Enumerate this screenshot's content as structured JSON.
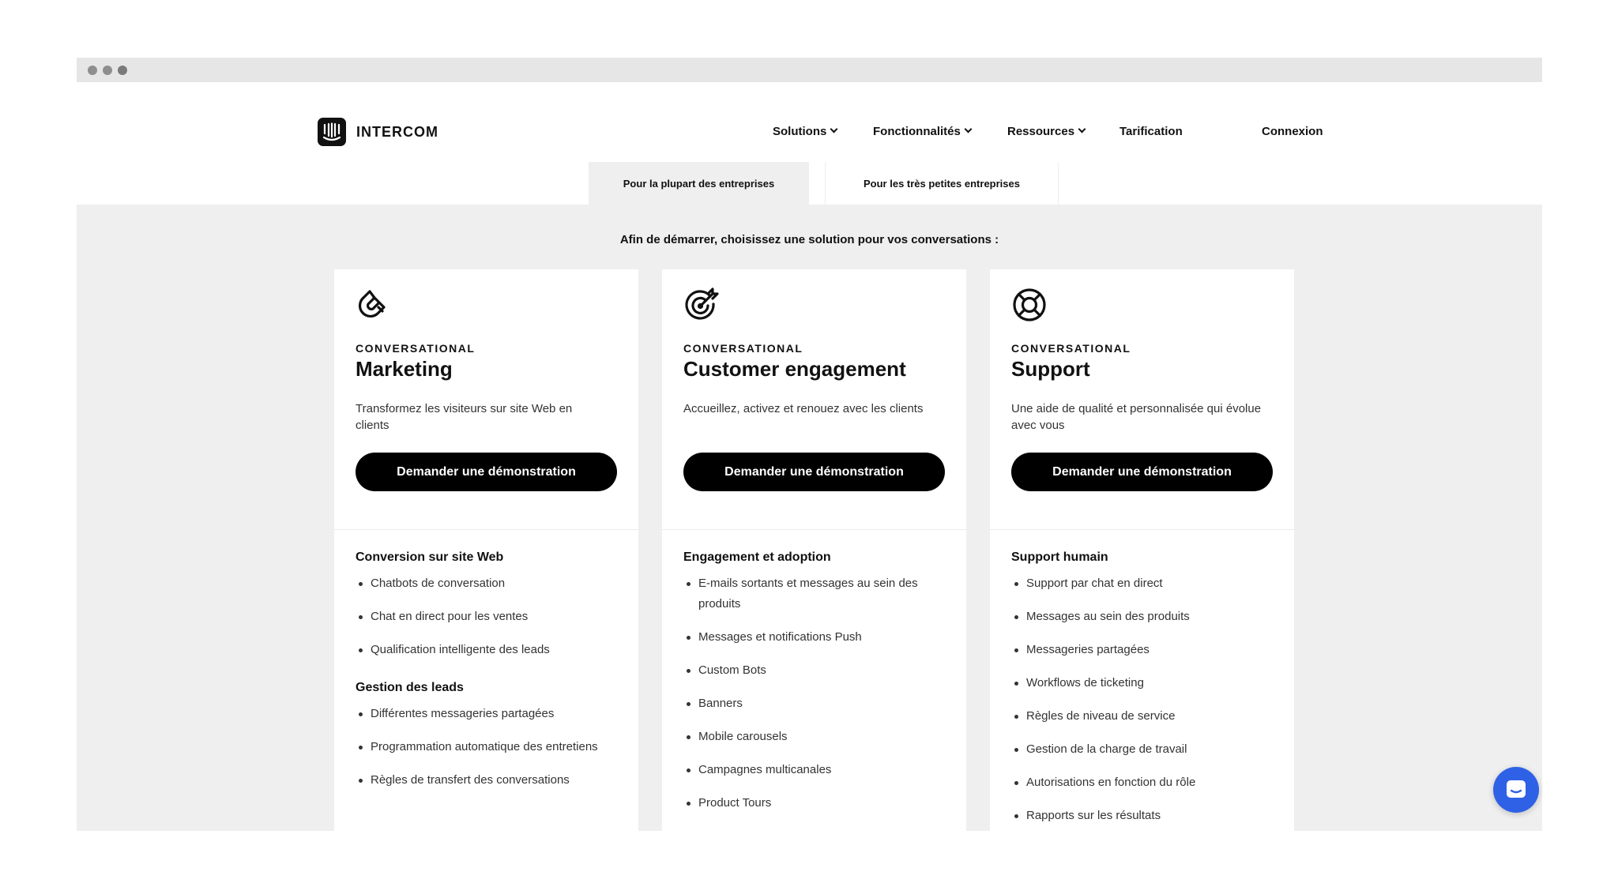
{
  "header": {
    "logo_text": "INTERCOM",
    "nav": [
      {
        "label": "Solutions",
        "has_dropdown": true
      },
      {
        "label": "Fonctionnalités",
        "has_dropdown": true
      },
      {
        "label": "Ressources",
        "has_dropdown": true
      },
      {
        "label": "Tarification",
        "has_dropdown": false
      }
    ],
    "login": "Connexion",
    "subtabs": [
      {
        "label": "Pour la plupart des entreprises",
        "active": true
      },
      {
        "label": "Pour les très petites entreprises",
        "active": false
      }
    ]
  },
  "main": {
    "intro": "Afin de démarrer, choisissez une solution pour vos conversations :",
    "cards": [
      {
        "icon": "magnet-icon",
        "eyebrow": "CONVERSATIONAL",
        "title": "Marketing",
        "description": "Transformez les visiteurs sur site Web en clients",
        "cta": "Demander une démonstration",
        "groups": [
          {
            "title": "Conversion sur site Web",
            "items": [
              "Chatbots de conversation",
              "Chat en direct pour les ventes",
              "Qualification intelligente des leads"
            ]
          },
          {
            "title": "Gestion des leads",
            "items": [
              "Différentes messageries partagées",
              "Programmation automatique des entretiens",
              "Règles de transfert des conversations"
            ]
          }
        ]
      },
      {
        "icon": "target-icon",
        "eyebrow": "CONVERSATIONAL",
        "title": "Customer engagement",
        "description": "Accueillez, activez et renouez avec les clients",
        "cta": "Demander une démonstration",
        "groups": [
          {
            "title": "Engagement et adoption",
            "items": [
              "E-mails sortants et messages au sein des produits",
              "Messages et notifications Push",
              "Custom Bots",
              "Banners",
              "Mobile carousels",
              "Campagnes multicanales",
              "Product Tours"
            ]
          }
        ]
      },
      {
        "icon": "lifebuoy-icon",
        "eyebrow": "CONVERSATIONAL",
        "title": "Support",
        "description": "Une aide de qualité et personnalisée qui évolue avec vous",
        "cta": "Demander une démonstration",
        "groups": [
          {
            "title": "Support humain",
            "items": [
              "Support par chat en direct",
              "Messages au sein des produits",
              "Messageries partagées",
              "Workflows de ticketing",
              "Règles de niveau de service",
              "Gestion de la charge de travail",
              "Autorisations en fonction du rôle",
              "Rapports sur les résultats"
            ]
          }
        ]
      }
    ]
  },
  "chat_launcher": {
    "icon": "chat-bubble-icon",
    "color": "#2f61e6"
  }
}
